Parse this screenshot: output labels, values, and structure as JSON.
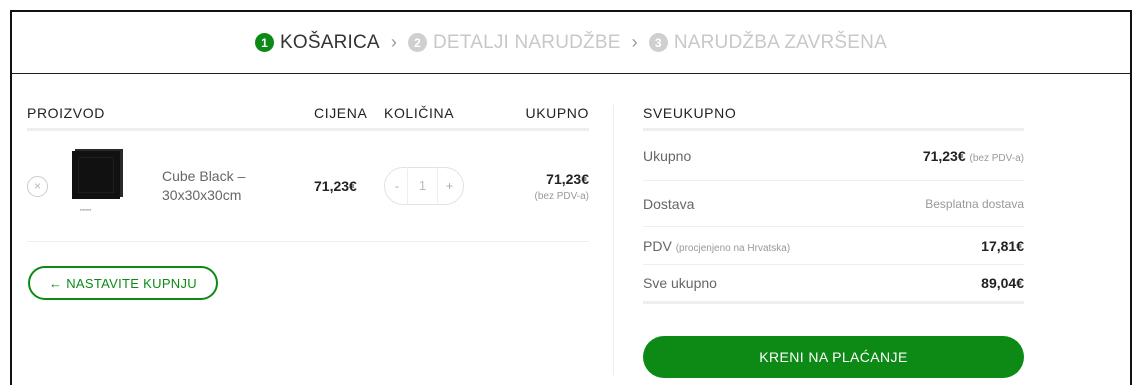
{
  "steps": [
    {
      "num": "1",
      "label": "KOŠARICA",
      "active": true
    },
    {
      "num": "2",
      "label": "DETALJI NARUDŽBE",
      "active": false
    },
    {
      "num": "3",
      "label": "NARUDŽBA ZAVRŠENA",
      "active": false
    }
  ],
  "separator": "›",
  "cart": {
    "headers": {
      "product": "PROIZVOD",
      "price": "CIJENA",
      "qty": "KOLIČINA",
      "total": "UKUPNO"
    },
    "items": [
      {
        "remove_icon": "×",
        "name": "Cube Black – 30x30x30cm",
        "price": "71,23€",
        "qty_minus": "-",
        "qty": "1",
        "qty_plus": "+",
        "total": "71,23€",
        "total_note": "(bez PDV-a)"
      }
    ],
    "continue_label": "← NASTAVITE KUPNJU"
  },
  "totals": {
    "title": "SVEUKUPNO",
    "subtotal_label": "Ukupno",
    "subtotal_value": "71,23€",
    "subtotal_note": "(bez PDV-a)",
    "shipping_label": "Dostava",
    "shipping_value": "Besplatna dostava",
    "vat_label": "PDV",
    "vat_note": "(procjenjeno na Hrvatska)",
    "vat_value": "17,81€",
    "grand_label": "Sve ukupno",
    "grand_value": "89,04€",
    "checkout_label": "KRENI NA PLAĆANJE"
  },
  "colors": {
    "accent": "#0d8a16"
  }
}
